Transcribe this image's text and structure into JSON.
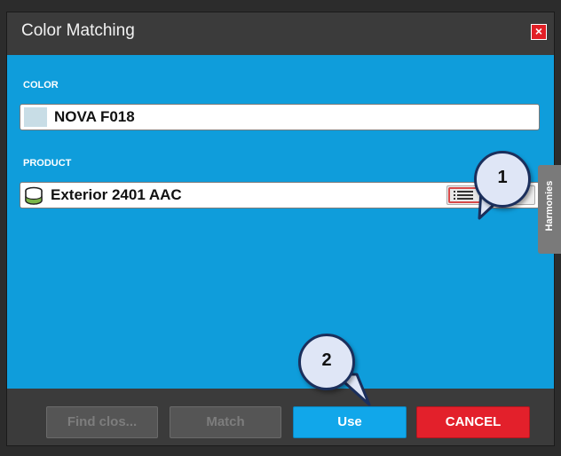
{
  "dialog": {
    "title": "Color Matching",
    "close_icon": "×"
  },
  "color_section": {
    "label": "COLOR",
    "value": "NOVA F018"
  },
  "product_section": {
    "label": "PRODUCT",
    "value": "Exterior 2401 AAC"
  },
  "side_tab": {
    "label": "Harmonies"
  },
  "callouts": {
    "one": "1",
    "two": "2"
  },
  "footer": {
    "find_closest": "Find clos...",
    "match": "Match",
    "use": "Use",
    "cancel": "CANCEL"
  },
  "colors": {
    "dialog_bg": "#0f9ddb",
    "titlebar": "#3b3b3b",
    "use_button": "#11a7ea",
    "cancel_button": "#e3202b"
  }
}
